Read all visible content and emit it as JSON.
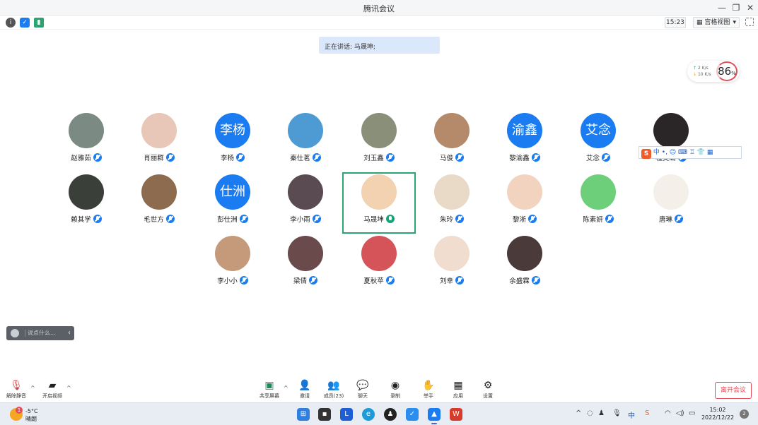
{
  "window": {
    "title": "腾讯会议"
  },
  "topbar": {
    "time": "15:23",
    "view_mode": "宫格视图"
  },
  "speaking_banner": "正在讲话: 马晟坤;",
  "network": {
    "upload": "2 K/s",
    "download": "10 K/s",
    "score": "86",
    "score_unit": "%"
  },
  "participants": [
    {
      "name": "赵雅茹",
      "avatar_text": "",
      "avatar_color": "#7c8a84"
    },
    {
      "name": "肖丽群",
      "avatar_text": "",
      "avatar_color": "#e8c6b8"
    },
    {
      "name": "李杨",
      "avatar_text": "李杨",
      "avatar_color": "#1a7cf0"
    },
    {
      "name": "秦仕茗",
      "avatar_text": "",
      "avatar_color": "#4e9bd4"
    },
    {
      "name": "刘玉鑫",
      "avatar_text": "",
      "avatar_color": "#8a8f7a"
    },
    {
      "name": "马俊",
      "avatar_text": "",
      "avatar_color": "#b48a6a"
    },
    {
      "name": "黎渝鑫",
      "avatar_text": "渝鑫",
      "avatar_color": "#1a7cf0"
    },
    {
      "name": "艾念",
      "avatar_text": "艾念",
      "avatar_color": "#1a7cf0"
    },
    {
      "name": "程美涵",
      "avatar_text": "",
      "avatar_color": "#2a2526"
    },
    {
      "name": "赖其学",
      "avatar_text": "",
      "avatar_color": "#3b3f3a"
    },
    {
      "name": "毛世方",
      "avatar_text": "",
      "avatar_color": "#8c6b4f"
    },
    {
      "name": "彭仕洲",
      "avatar_text": "仕洲",
      "avatar_color": "#1a7cf0"
    },
    {
      "name": "李小雨",
      "avatar_text": "",
      "avatar_color": "#5a4a52"
    },
    {
      "name": "马晟坤",
      "avatar_text": "",
      "avatar_color": "#f3d2b2"
    },
    {
      "name": "朱玲",
      "avatar_text": "",
      "avatar_color": "#e9d9c7"
    },
    {
      "name": "黎淅",
      "avatar_text": "",
      "avatar_color": "#f1d3c0"
    },
    {
      "name": "陈素妍",
      "avatar_text": "",
      "avatar_color": "#6ecf7a"
    },
    {
      "name": "唐琳",
      "avatar_text": "",
      "avatar_color": "#f4efe9"
    },
    {
      "name": "李小小",
      "avatar_text": "",
      "avatar_color": "#c59a7a"
    },
    {
      "name": "梁倩",
      "avatar_text": "",
      "avatar_color": "#6a4a4a"
    },
    {
      "name": "夏秋苹",
      "avatar_text": "",
      "avatar_color": "#d4545a"
    },
    {
      "name": "刘幸",
      "avatar_text": "",
      "avatar_color": "#f0ddd0"
    },
    {
      "name": "余盛霖",
      "avatar_text": "",
      "avatar_color": "#4a3a3a"
    }
  ],
  "ime": {
    "logo": "S",
    "mode": "中",
    "extras": "•, ☺ ⌨ ♖ 👕 ▦"
  },
  "chat": {
    "placeholder": "说点什么..."
  },
  "controls": {
    "unmute": "解除静音",
    "video": "开启视频",
    "share": "共享屏幕",
    "invite": "邀请",
    "members": "成员(23)",
    "chat": "聊天",
    "record": "录制",
    "raise_hand": "举手",
    "apps": "应用",
    "settings": "设置",
    "leave": "离开会议"
  },
  "taskbar": {
    "weather_temp": "-5°C",
    "weather_cond": "晴朗",
    "weather_badge": "1",
    "time": "15:02",
    "date": "2022/12/22",
    "notifications": "2",
    "ime_indicator": "中"
  },
  "colors": {
    "accent": "#1a7cf0",
    "speaking": "#2ba471",
    "danger": "#e34d59"
  }
}
